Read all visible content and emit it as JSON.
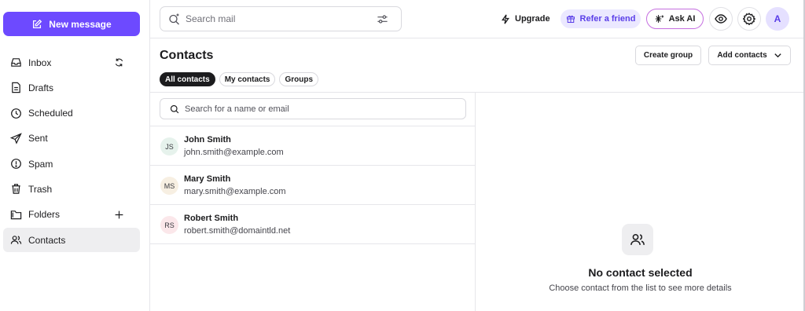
{
  "sidebar": {
    "new_message": "New message",
    "items": [
      {
        "label": "Inbox",
        "icon": "inbox-icon"
      },
      {
        "label": "Drafts",
        "icon": "drafts-icon"
      },
      {
        "label": "Scheduled",
        "icon": "clock-icon"
      },
      {
        "label": "Sent",
        "icon": "send-icon"
      },
      {
        "label": "Spam",
        "icon": "spam-icon"
      },
      {
        "label": "Trash",
        "icon": "trash-icon"
      },
      {
        "label": "Folders",
        "icon": "folder-icon"
      },
      {
        "label": "Contacts",
        "icon": "contacts-icon",
        "active": true
      }
    ]
  },
  "topbar": {
    "search_placeholder": "Search mail",
    "upgrade": "Upgrade",
    "refer": "Refer a friend",
    "ask_ai": "Ask AI",
    "avatar_initial": "A"
  },
  "contacts": {
    "title": "Contacts",
    "create_group": "Create group",
    "add_contacts": "Add contacts",
    "tabs": [
      "All contacts",
      "My contacts",
      "Groups"
    ],
    "active_tab": "All contacts",
    "search_placeholder": "Search for a name or email",
    "list": [
      {
        "initials": "JS",
        "name": "John Smith",
        "email": "john.smith@example.com",
        "color": "#e6f2ec"
      },
      {
        "initials": "MS",
        "name": "Mary Smith",
        "email": "mary.smith@example.com",
        "color": "#f7efe2"
      },
      {
        "initials": "RS",
        "name": "Robert Smith",
        "email": "robert.smith@domaintld.net",
        "color": "#fbe7ea"
      }
    ]
  },
  "detail": {
    "empty_title": "No contact selected",
    "empty_subtitle": "Choose contact from the list to see more details"
  },
  "colors": {
    "accent": "#6d4aff",
    "refer_bg": "#ebe8ff",
    "ask_ai_border": "#c56fe0"
  }
}
